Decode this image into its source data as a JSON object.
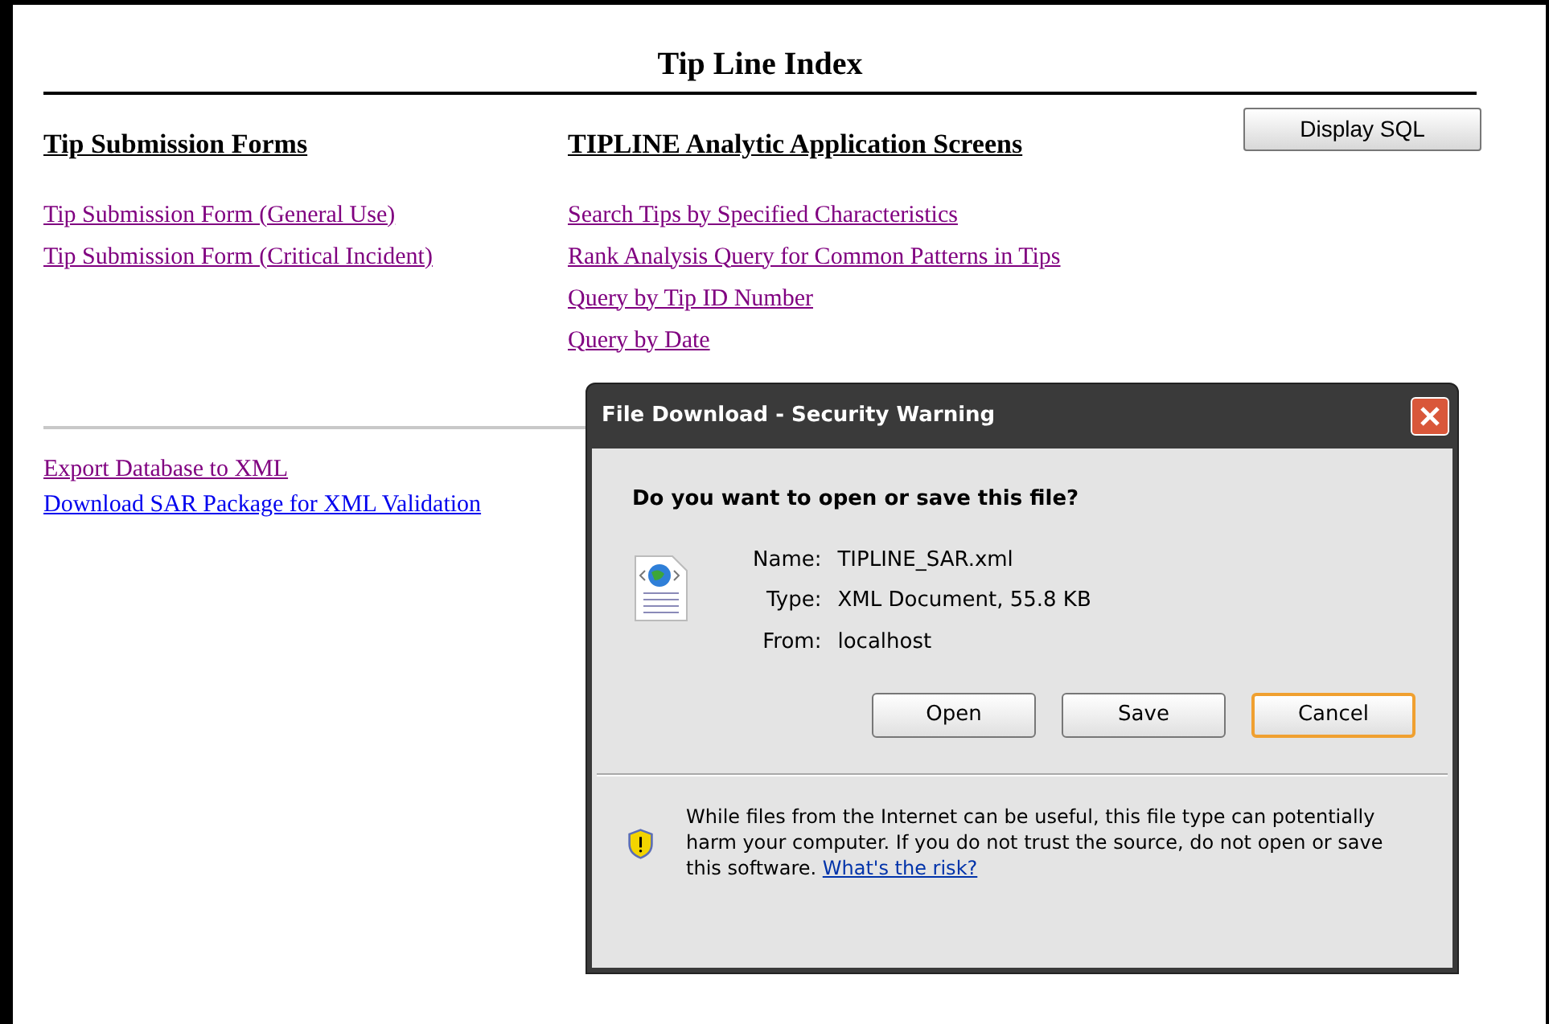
{
  "page": {
    "title": "Tip Line Index",
    "display_sql_button": "Display SQL",
    "columns": [
      {
        "heading": "Tip Submission Forms",
        "links": [
          {
            "label": "Tip Submission Form (General Use)",
            "visited": true
          },
          {
            "label": "Tip Submission Form (Critical Incident)",
            "visited": true
          }
        ]
      },
      {
        "heading": "TIPLINE Analytic Application Screens",
        "links": [
          {
            "label": "Search Tips by Specified Characteristics",
            "visited": true
          },
          {
            "label": "Rank Analysis Query for Common Patterns in Tips",
            "visited": true
          },
          {
            "label": "Query by Tip ID Number",
            "visited": true
          },
          {
            "label": "Query by Date",
            "visited": true
          }
        ]
      }
    ],
    "bottom_links": [
      {
        "label": "Export Database to XML",
        "visited": true
      },
      {
        "label": "Download SAR Package for XML Validation",
        "visited": false
      }
    ]
  },
  "dialog": {
    "title": "File Download - Security Warning",
    "question": "Do you want to open or save this file?",
    "fields": [
      {
        "label": "Name:",
        "value": "TIPLINE_SAR.xml"
      },
      {
        "label": "Type:",
        "value": "XML Document, 55.8 KB"
      },
      {
        "label": "From:",
        "value": "localhost"
      }
    ],
    "buttons": [
      {
        "label": "Open",
        "focused": false
      },
      {
        "label": "Save",
        "focused": false
      },
      {
        "label": "Cancel",
        "focused": true
      }
    ],
    "warning": "While files from the Internet can be useful, this file type can potentially harm your computer. If you do not trust the source, do not open or save this software.",
    "risk_link": "What's the risk?"
  }
}
